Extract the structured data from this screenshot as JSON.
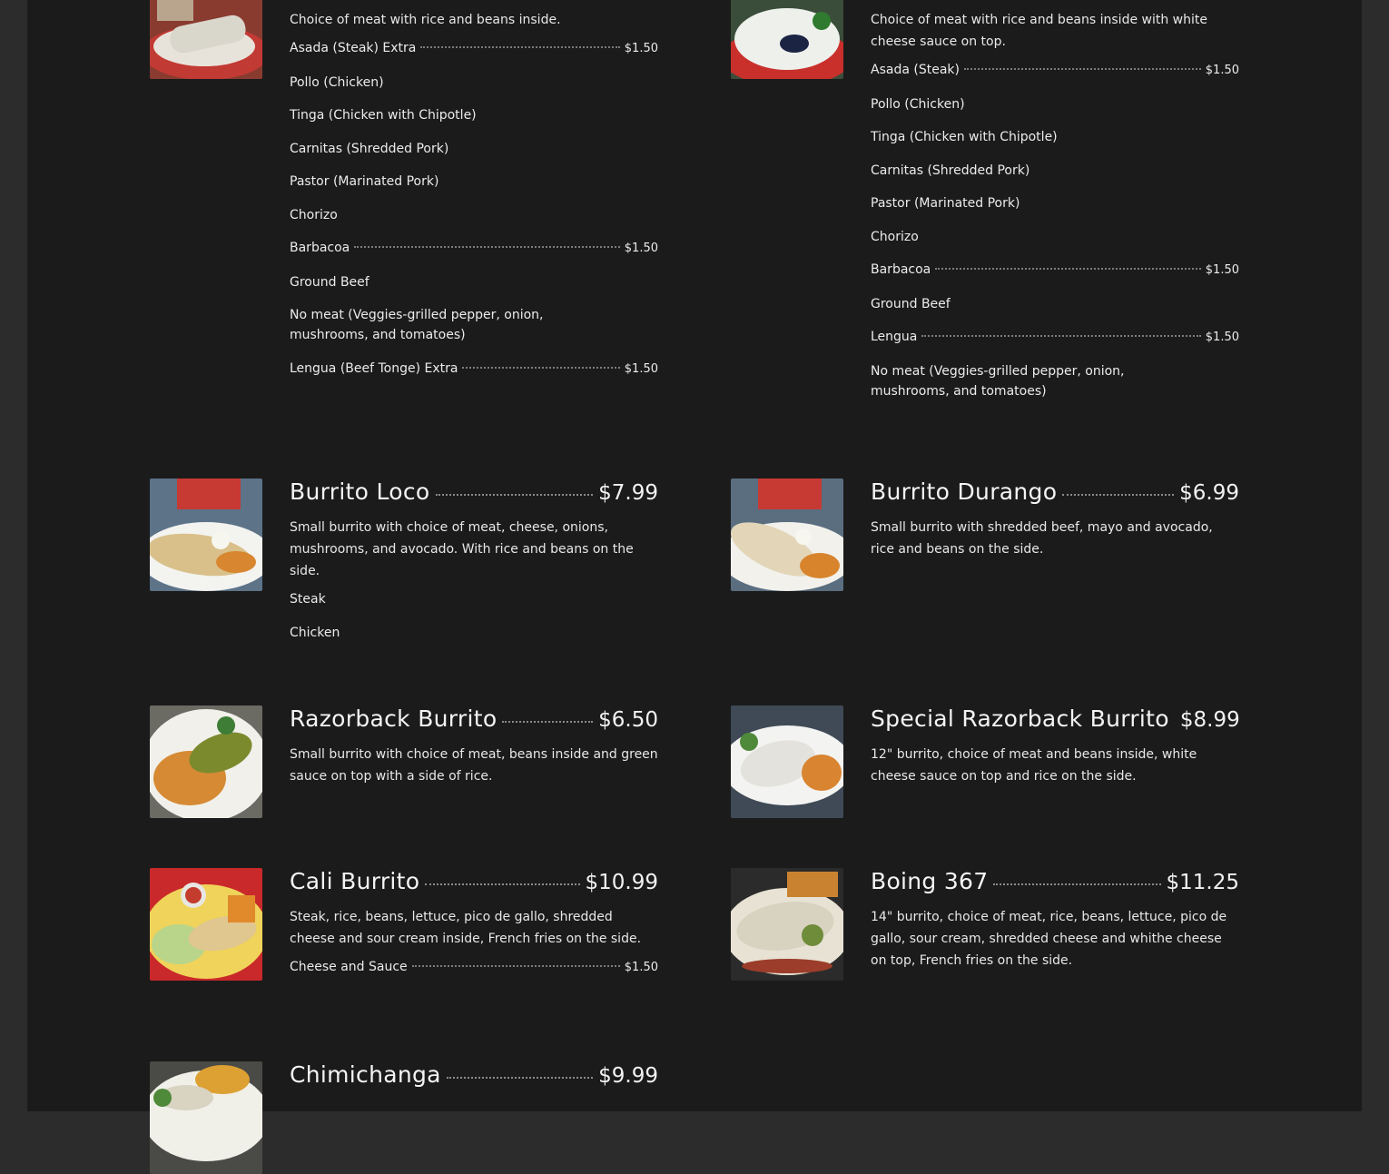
{
  "menu": {
    "items": [
      {
        "id": "burrito-1",
        "title": "",
        "price": "",
        "description": "Choice of meat with rice and beans inside.",
        "options": [
          {
            "label": "Asada (Steak) Extra",
            "price": "$1.50"
          },
          {
            "label": "Pollo (Chicken)",
            "price": ""
          },
          {
            "label": "Tinga (Chicken with Chipotle)",
            "price": ""
          },
          {
            "label": "Carnitas (Shredded Pork)",
            "price": ""
          },
          {
            "label": "Pastor (Marinated Pork)",
            "price": ""
          },
          {
            "label": "Chorizo",
            "price": ""
          },
          {
            "label": "Barbacoa",
            "price": "$1.50"
          },
          {
            "label": "Ground Beef",
            "price": ""
          },
          {
            "label": "No meat (Veggies-grilled pepper, onion, mushrooms, and tomatoes)",
            "price": ""
          },
          {
            "label": "Lengua (Beef Tonge) Extra",
            "price": "$1.50"
          }
        ]
      },
      {
        "id": "burrito-2",
        "title": "",
        "price": "",
        "description": "Choice of meat with rice and beans inside with white cheese sauce on top.",
        "options": [
          {
            "label": "Asada (Steak)",
            "price": "$1.50"
          },
          {
            "label": "Pollo (Chicken)",
            "price": ""
          },
          {
            "label": "Tinga (Chicken with Chipotle)",
            "price": ""
          },
          {
            "label": "Carnitas (Shredded Pork)",
            "price": ""
          },
          {
            "label": "Pastor (Marinated Pork)",
            "price": ""
          },
          {
            "label": "Chorizo",
            "price": ""
          },
          {
            "label": "Barbacoa",
            "price": "$1.50"
          },
          {
            "label": "Ground Beef",
            "price": ""
          },
          {
            "label": "Lengua",
            "price": "$1.50"
          },
          {
            "label": "No meat (Veggies-grilled pepper, onion, mushrooms, and tomatoes)",
            "price": ""
          }
        ]
      },
      {
        "id": "burrito-loco",
        "title": "Burrito Loco",
        "price": "$7.99",
        "description": "Small burrito with choice of meat, cheese, onions, mushrooms, and avocado. With rice and beans on the side.",
        "options": [
          {
            "label": "Steak",
            "price": ""
          },
          {
            "label": "Chicken",
            "price": ""
          }
        ]
      },
      {
        "id": "burrito-durango",
        "title": "Burrito Durango",
        "price": "$6.99",
        "description": "Small burrito with shredded beef, mayo and avocado, rice and beans on the side.",
        "options": []
      },
      {
        "id": "razorback-burrito",
        "title": "Razorback Burrito",
        "price": "$6.50",
        "description": "Small burrito with choice of meat, beans inside and green sauce on top with a side of rice.",
        "options": []
      },
      {
        "id": "special-razorback-burrito",
        "title": "Special Razorback Burrito",
        "price": "$8.99",
        "description": "12\" burrito, choice of meat and beans inside, white cheese sauce on top and rice on the side.",
        "options": []
      },
      {
        "id": "cali-burrito",
        "title": "Cali Burrito",
        "price": "$10.99",
        "description": "Steak, rice, beans, lettuce, pico de gallo, shredded cheese and sour cream inside, French fries on the side.",
        "options": [
          {
            "label": "Cheese and Sauce",
            "price": "$1.50"
          }
        ]
      },
      {
        "id": "boing-367",
        "title": "Boing 367",
        "price": "$11.25",
        "description": "14\" burrito, choice of meat, rice, beans, lettuce, pico de gallo, sour cream, shredded cheese and whithe cheese on top, French fries on the side.",
        "options": []
      },
      {
        "id": "chimichanga",
        "title": "Chimichanga",
        "price": "$9.99",
        "description": "",
        "options": []
      }
    ]
  },
  "colors": {
    "page_bg": "#2c2c2c",
    "panel_bg": "#1b1b1b",
    "text": "#f2f2f2",
    "dots": "#8a8a8a"
  }
}
